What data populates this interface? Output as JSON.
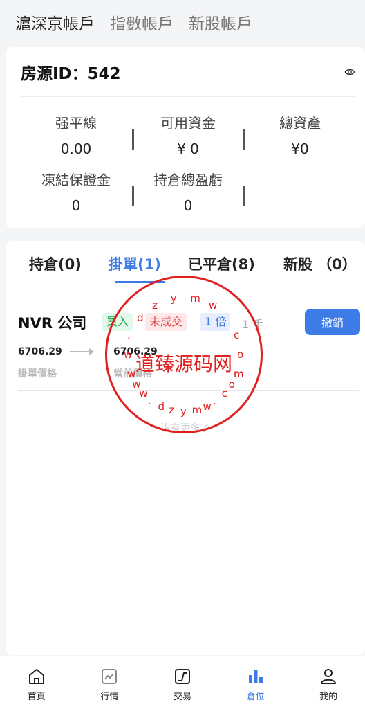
{
  "top_tabs": [
    {
      "label": "滬深京帳戶",
      "active": true
    },
    {
      "label": "指數帳戶",
      "active": false
    },
    {
      "label": "新股帳戶",
      "active": false
    }
  ],
  "account": {
    "title": "房源ID：542",
    "stats": [
      {
        "label": "强平線",
        "value": "0.00"
      },
      {
        "label": "可用資金",
        "value": "¥ 0"
      },
      {
        "label": "總資產",
        "value": "¥0"
      },
      {
        "label": "凍結保證金",
        "value": "0"
      },
      {
        "label": "持倉總盈虧",
        "value": "0"
      }
    ]
  },
  "order_tabs": [
    {
      "label": "持倉(0)",
      "active": false
    },
    {
      "label": "掛單(1)",
      "active": true
    },
    {
      "label": "已平倉(8)",
      "active": false
    },
    {
      "label": "新股 （0）",
      "active": false
    }
  ],
  "order": {
    "name": "NVR 公司",
    "side": "買入",
    "status": "未成交",
    "leverage": "1 倍",
    "quantity": "1 手",
    "cancel_label": "撤銷",
    "order_price": "6706.29",
    "order_price_label": "掛單價格",
    "current_price": "6706.29",
    "current_price_label": "當前價格"
  },
  "no_more_text": "沒有更多了",
  "watermark": {
    "text": "道臻源码网",
    "ring_top": [
      "w",
      "w",
      ".",
      "d",
      "z",
      "y",
      "m",
      "w",
      ".",
      "c",
      "o",
      "m"
    ],
    "ring_bottom": [
      "w",
      "w",
      "w",
      ".",
      "d",
      "z",
      "y",
      "m",
      "w",
      ".",
      "c",
      "o",
      "m"
    ]
  },
  "bottom_nav": [
    {
      "label": "首頁",
      "icon": "home-icon",
      "active": false
    },
    {
      "label": "行情",
      "icon": "chart-icon",
      "active": false
    },
    {
      "label": "交易",
      "icon": "trade-icon",
      "active": false
    },
    {
      "label": "倉位",
      "icon": "position-icon",
      "active": true
    },
    {
      "label": "我的",
      "icon": "profile-icon",
      "active": false
    }
  ],
  "colors": {
    "accent": "#3d7be6",
    "buy": "#27b05d",
    "status_red": "#e64545",
    "watermark": "#e02020"
  }
}
